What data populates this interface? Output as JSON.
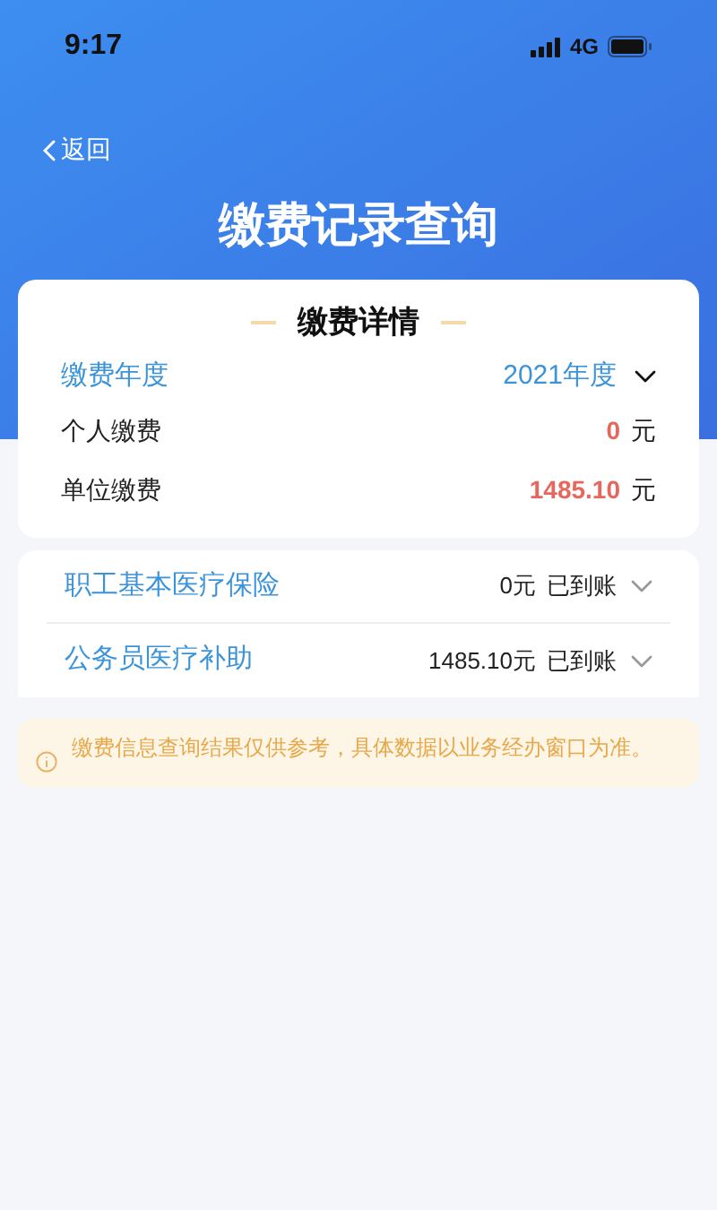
{
  "status_bar": {
    "time": "9:17",
    "network": "4G"
  },
  "nav": {
    "back": "返回",
    "title": "缴费记录查询"
  },
  "detail_card": {
    "title": "缴费详情",
    "year_label": "缴费年度",
    "year_value": "2021年度",
    "rows": [
      {
        "label": "个人缴费",
        "amount": "0",
        "unit": "元"
      },
      {
        "label": "单位缴费",
        "amount": "1485.10",
        "unit": "元"
      }
    ]
  },
  "items": [
    {
      "name": "职工基本医疗保险",
      "amount": "0元",
      "status": "已到账",
      "expanded": false
    },
    {
      "name": "公务员医疗补助",
      "amount": "1485.10元",
      "status": "已到账",
      "expanded": false
    }
  ],
  "notice": "缴费信息查询结果仅供参考，具体数据以业务经办窗口为准。"
}
